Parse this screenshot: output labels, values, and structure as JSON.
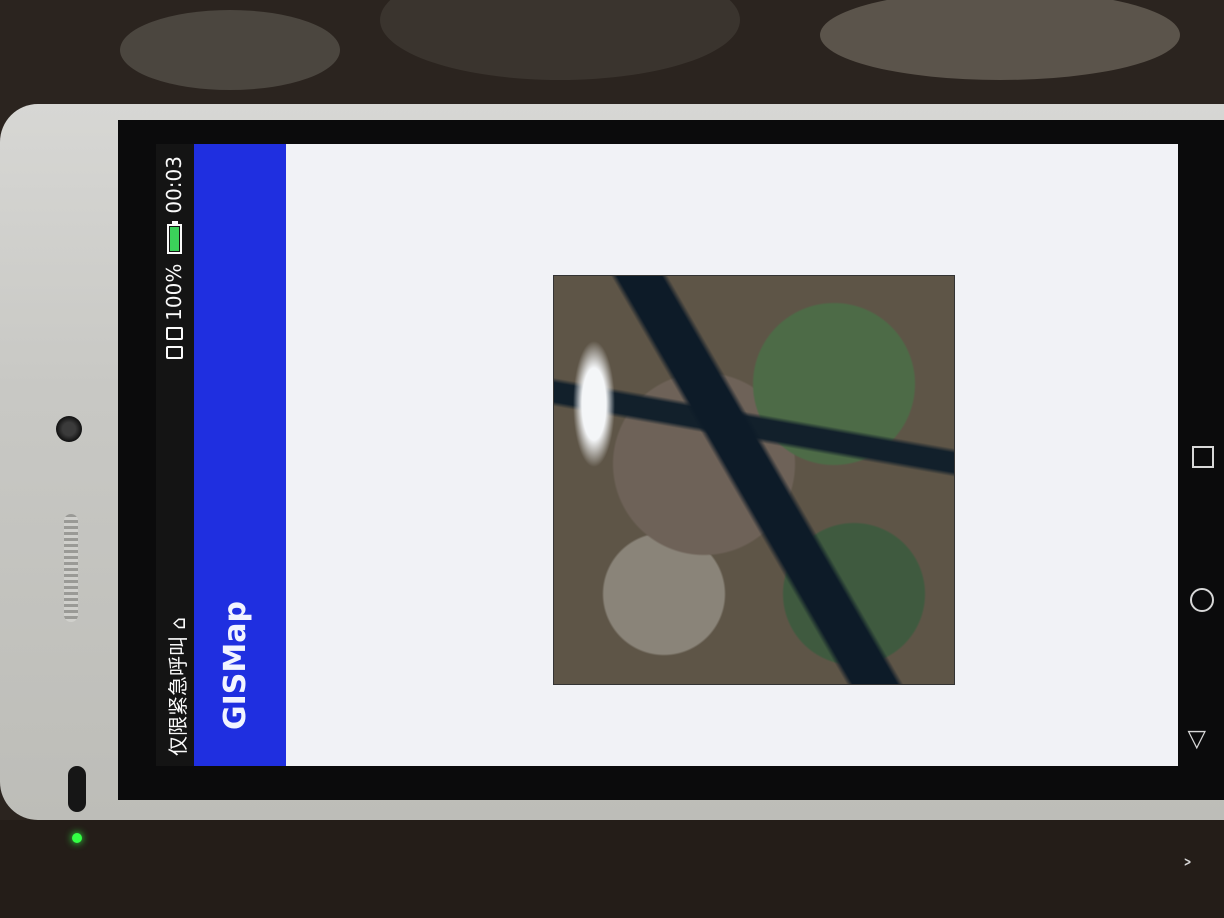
{
  "status_bar": {
    "carrier": "仅限紧急呼叫 ⌂",
    "battery": "100%",
    "time": "00:03",
    "icons": [
      "sim-card-icon",
      "sim-card-icon",
      "battery-charging-icon"
    ]
  },
  "app_bar": {
    "title": "GISMap",
    "color": "#1f2fe0"
  },
  "main": {
    "image": "satellite-map-image"
  },
  "nav_bar": {
    "buttons": [
      "recent-apps-icon",
      "home-icon",
      "back-icon",
      "expand-icon"
    ]
  }
}
